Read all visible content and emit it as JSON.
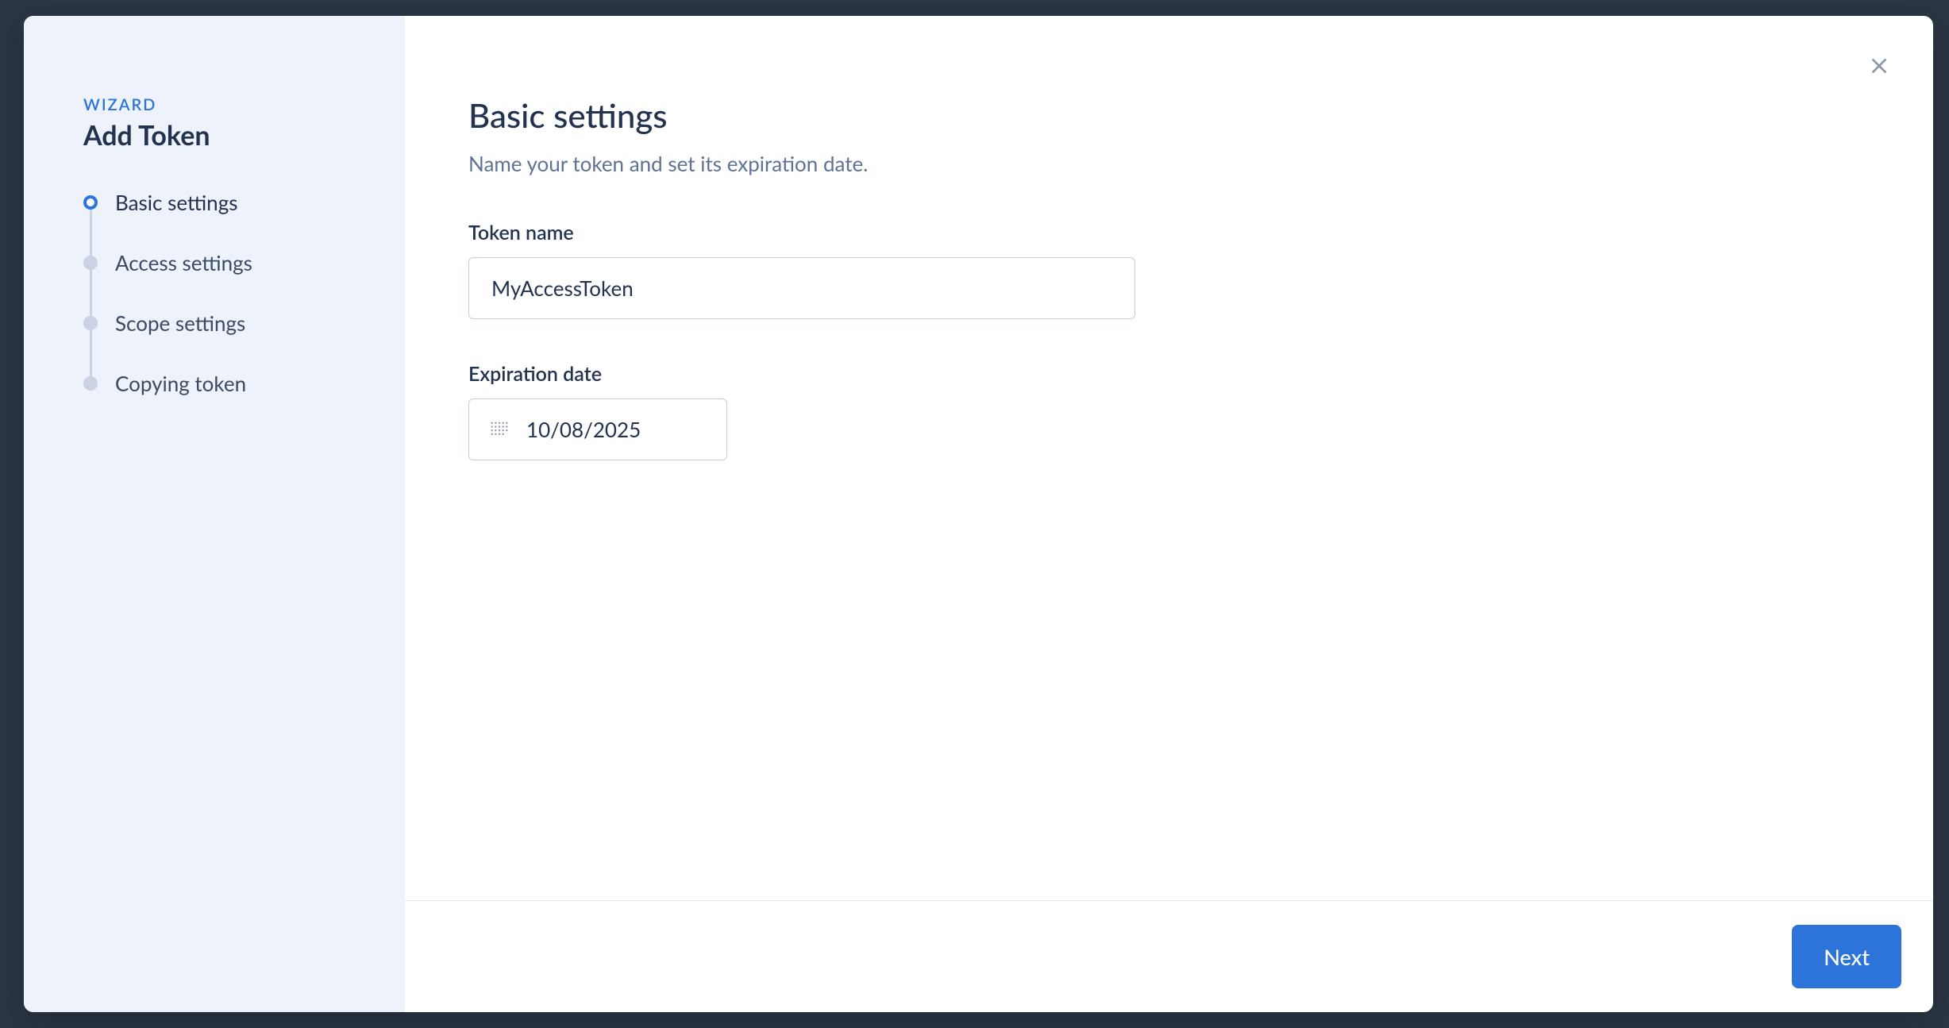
{
  "sidebar": {
    "wizard_label": "WIZARD",
    "wizard_title": "Add Token",
    "steps": [
      {
        "label": "Basic settings",
        "active": true
      },
      {
        "label": "Access settings",
        "active": false
      },
      {
        "label": "Scope settings",
        "active": false
      },
      {
        "label": "Copying token",
        "active": false
      }
    ]
  },
  "main": {
    "title": "Basic settings",
    "subtitle": "Name your token and set its expiration date.",
    "token_name_label": "Token name",
    "token_name_value": "MyAccessToken",
    "expiration_label": "Expiration date",
    "expiration_value": "10/08/2025"
  },
  "footer": {
    "next_label": "Next"
  },
  "icons": {
    "close": "close-icon",
    "calendar": "calendar-icon"
  }
}
